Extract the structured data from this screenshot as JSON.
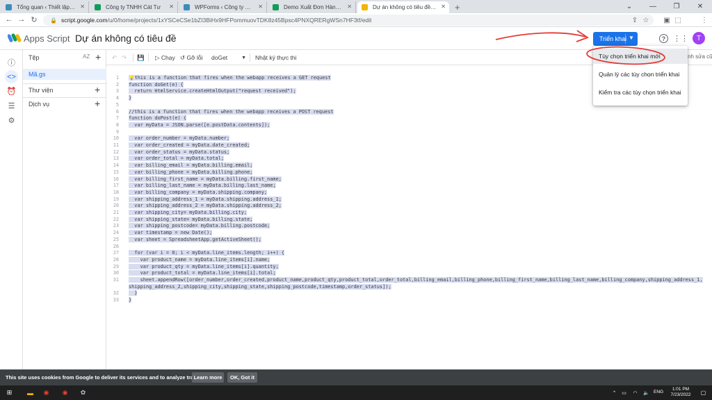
{
  "browser": {
    "tabs": [
      {
        "label": "Tổng quan ‹ Thiết lập ‹ Công ty",
        "favicon_color": "#3c8dbc"
      },
      {
        "label": "Công ty TNHH Cát Tư",
        "favicon_color": "#0f9d58"
      },
      {
        "label": "WPForms ‹ Công ty TNHH Cát Tư",
        "favicon_color": "#3c8dbc"
      },
      {
        "label": "Demo Xuất Đơn Hàng Từ Woocom",
        "favicon_color": "#0f9d58"
      },
      {
        "label": "Dự án không có tiêu đề - Trình c",
        "favicon_color": "#f4b400"
      }
    ],
    "url_host": "script.google.com",
    "url_path": "/u/0/home/projects/1xYSCeCSe1bZI3BiHx9HFPommuovTDK8z45Bpsc4PNXQRERgWSn7HF3tf/edit",
    "profile_initial": "T"
  },
  "app": {
    "brand": "Apps Script",
    "project_title": "Dự án không có tiêu đề",
    "deploy_label": "Triển khai",
    "avatar_initial": "T"
  },
  "files_panel": {
    "header": "Tệp",
    "sort_label": "AZ",
    "file": "Mã.gs",
    "sections": [
      "Thư viện",
      "Dịch vụ"
    ]
  },
  "toolbar": {
    "run_label": "Chạy",
    "debug_label": "Gỡ lỗi",
    "function_name": "doGet",
    "log_label": "Nhật ký thực thi",
    "right_label": "nh sửa cũ"
  },
  "code_lines": [
    {
      "n": "1",
      "t": "💡this is a function that fires when the webapp receives a GET request"
    },
    {
      "n": "2",
      "t": "function doGet(e) {"
    },
    {
      "n": "3",
      "t": "  return HtmlService.createHtmlOutput(\"request received\");"
    },
    {
      "n": "4",
      "t": "}"
    },
    {
      "n": "5",
      "t": ""
    },
    {
      "n": "6",
      "t": "//this is a function that fires when the webapp receives a POST request"
    },
    {
      "n": "7",
      "t": "function doPost(e) {"
    },
    {
      "n": "8",
      "t": "  var myData = JSON.parse([e.postData.contents]);"
    },
    {
      "n": "9",
      "t": ""
    },
    {
      "n": "10",
      "t": "  var order_number = myData.number;"
    },
    {
      "n": "11",
      "t": "  var order_created = myData.date_created;"
    },
    {
      "n": "12",
      "t": "  var order_status = myData.status;"
    },
    {
      "n": "13",
      "t": "  var order_total = myData.total;"
    },
    {
      "n": "14",
      "t": "  var billing_email = myData.billing.email;"
    },
    {
      "n": "15",
      "t": "  var billing_phone = myData.billing.phone;"
    },
    {
      "n": "16",
      "t": "  var billing_first_name = myData.billing.first_name;"
    },
    {
      "n": "17",
      "t": "  var billing_last_name = myData.billing.last_name;"
    },
    {
      "n": "18",
      "t": "  var billing_company = myData.shipping.company;"
    },
    {
      "n": "19",
      "t": "  var shipping_address_1 = myData.shipping.address_1;"
    },
    {
      "n": "20",
      "t": "  var shipping_address_2 = myData.shipping.address_2;"
    },
    {
      "n": "21",
      "t": "  var shipping_city= myData.billing.city;"
    },
    {
      "n": "22",
      "t": "  var shipping_state= myData.billing.state;"
    },
    {
      "n": "23",
      "t": "  var shipping_postcode= myData.billing.postcode;"
    },
    {
      "n": "24",
      "t": "  var timestamp = new Date();"
    },
    {
      "n": "25",
      "t": "  var sheet = SpreadsheetApp.getActiveSheet();"
    },
    {
      "n": "26",
      "t": ""
    },
    {
      "n": "27",
      "t": "  for (var i = 0; i < myData.line_items.length; i++) {"
    },
    {
      "n": "28",
      "t": "    var product_name = myData.line_items[i].name;"
    },
    {
      "n": "29",
      "t": "    var product_qty = myData.line_items[i].quantity;"
    },
    {
      "n": "30",
      "t": "    var product_total = myData.line_items[i].total;"
    },
    {
      "n": "31",
      "t": "    sheet.appendRow([order_number,order_created,product_name,product_qty,product_total,order_total,billing_email,billing_phone,billing_first_name,billing_last_name,billing_company,shipping_address_1,"
    },
    {
      "n": "",
      "t": "shipping_address_2,shipping_city,shipping_state,shipping_postcode,timestamp,order_status]);"
    },
    {
      "n": "32",
      "t": "  }"
    },
    {
      "n": "33",
      "t": "}"
    }
  ],
  "deploy_menu": [
    "Tùy chọn triển khai mới",
    "Quản lý các tùy chọn triển khai",
    "Kiểm tra các tùy chọn triển khai"
  ],
  "cookie_banner": {
    "text": "This site uses cookies from Google to deliver its services and to analyze traffic.",
    "learn_more": "Learn more",
    "ok": "OK, Got it"
  },
  "taskbar": {
    "lang": "ENG",
    "time": "1:01 PM",
    "date": "7/23/2022"
  },
  "colors": {
    "accent": "#1a73e8",
    "annotation": "#e53935"
  }
}
